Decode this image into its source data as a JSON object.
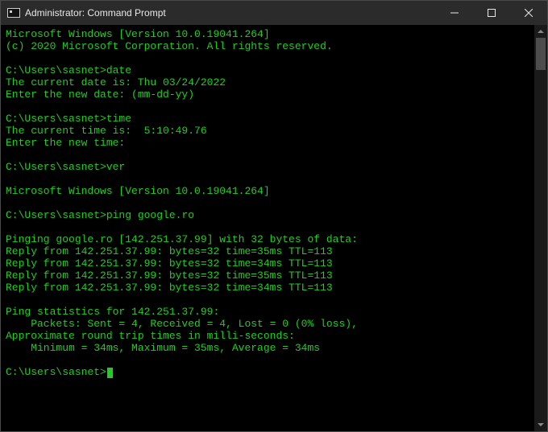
{
  "titlebar": {
    "title": "Administrator: Command Prompt"
  },
  "prompt": "C:\\Users\\sasnet>",
  "header": {
    "line1": "Microsoft Windows [Version 10.0.19041.264]",
    "line2": "(c) 2020 Microsoft Corporation. All rights reserved."
  },
  "date_cmd": {
    "prompt": "C:\\Users\\sasnet>",
    "command": "date",
    "result": "The current date is: Thu 03/24/2022",
    "input_prompt": "Enter the new date: (mm-dd-yy)"
  },
  "time_cmd": {
    "prompt": "C:\\Users\\sasnet>",
    "command": "time",
    "result": "The current time is:  5:10:49.76",
    "input_prompt": "Enter the new time:"
  },
  "ver_cmd": {
    "prompt": "C:\\Users\\sasnet>",
    "command": "ver",
    "result": "Microsoft Windows [Version 10.0.19041.264]"
  },
  "ping_cmd": {
    "prompt": "C:\\Users\\sasnet>",
    "command": "ping google.ro",
    "header": "Pinging google.ro [142.251.37.99] with 32 bytes of data:",
    "replies": [
      "Reply from 142.251.37.99: bytes=32 time=35ms TTL=113",
      "Reply from 142.251.37.99: bytes=32 time=34ms TTL=113",
      "Reply from 142.251.37.99: bytes=32 time=35ms TTL=113",
      "Reply from 142.251.37.99: bytes=32 time=34ms TTL=113"
    ],
    "stats_header": "Ping statistics for 142.251.37.99:",
    "packets": "    Packets: Sent = 4, Received = 4, Lost = 0 (0% loss),",
    "rtt_header": "Approximate round trip times in milli-seconds:",
    "rtt_values": "    Minimum = 34ms, Maximum = 35ms, Average = 34ms"
  },
  "final_prompt": "C:\\Users\\sasnet>"
}
